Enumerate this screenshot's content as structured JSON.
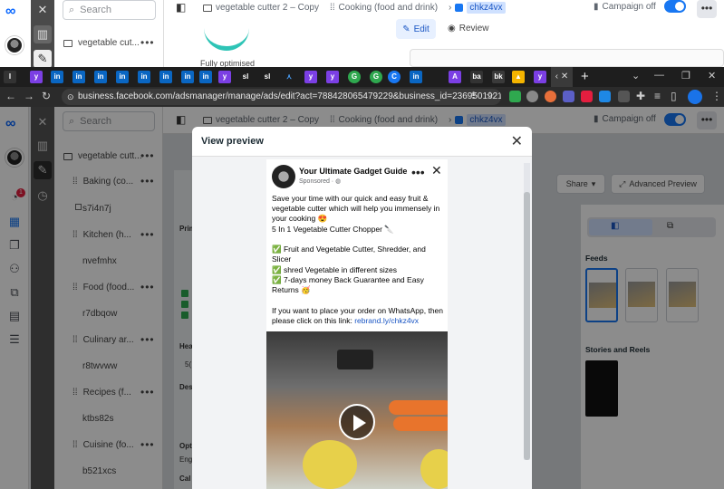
{
  "background_window": {
    "search_placeholder": "Search",
    "tree_item": "vegetable cut...",
    "tree_item2": "Baking (co...",
    "breadcrumb": {
      "campaign": "vegetable cutter 2 – Copy",
      "adset": "Cooking (food and drink)",
      "ad": "chkz4vx"
    },
    "campaign_status": "Campaign off",
    "edit_label": "Edit",
    "review_label": "Review",
    "fully_optimised": "Fully optimised"
  },
  "browser": {
    "url": "business.facebook.com/adsmanager/manage/ads/edit?act=788428065479229&business_id=23695019217...",
    "tab_icons": [
      "li",
      "li",
      "li",
      "li",
      "li",
      "li",
      "li",
      "li",
      "li",
      "y",
      "sl",
      "sl",
      "up",
      "y",
      "y",
      "g",
      "g",
      "c",
      "li",
      "a",
      "ba",
      "g",
      "y"
    ],
    "active_tab_label": "‹"
  },
  "sidebar": {
    "notification_count": "1"
  },
  "tree": {
    "items": [
      {
        "label": "vegetable cutt...",
        "kind": "campaign"
      },
      {
        "label": "Baking (co...",
        "kind": "adset"
      },
      {
        "label": "s7i4n7j",
        "kind": "ad"
      },
      {
        "label": "Kitchen (h...",
        "kind": "adset"
      },
      {
        "label": "nvefmhx",
        "kind": "ad"
      },
      {
        "label": "Food (food...",
        "kind": "adset"
      },
      {
        "label": "r7dbqow",
        "kind": "ad"
      },
      {
        "label": "Culinary ar...",
        "kind": "adset"
      },
      {
        "label": "r8twvww",
        "kind": "ad"
      },
      {
        "label": "Recipes (f...",
        "kind": "adset"
      },
      {
        "label": "ktbs82s",
        "kind": "ad"
      },
      {
        "label": "Cuisine (fo...",
        "kind": "adset"
      },
      {
        "label": "b521xcs",
        "kind": "ad"
      }
    ]
  },
  "topbar": {
    "breadcrumb": {
      "campaign": "vegetable cutter 2 – Copy",
      "adset": "Cooking (food and drink)",
      "ad": "chkz4vx"
    },
    "campaign_status": "Campaign off"
  },
  "right_panel": {
    "share_label": "Share",
    "advanced_preview_label": "Advanced Preview",
    "feeds_label": "Feeds",
    "stories_label": "Stories and Reels"
  },
  "left_content_ghosts": {
    "prim": "Prim",
    "head": "Hea",
    "desc": "Des",
    "opt": "Opt",
    "enga": "Enga",
    "cal": "Cal",
    "s5": "5("
  },
  "modal": {
    "title": "View preview",
    "ad": {
      "page_name": "Your Ultimate Gadget Guide",
      "sponsored": "Sponsored · ",
      "line1": "Save your time with our quick and easy fruit & vegetable cutter which will help you immensely in your cooking 😍",
      "line2": "5 In 1 Vegetable Cutter Chopper 🔪",
      "bullet1": "✅ Fruit and Vegetable Cutter, Shredder, and Slicer",
      "bullet2": "✅ shred Vegetable in different sizes",
      "bullet3": "✅ 7-days money Back Guarantee and Easy Returns 🥳",
      "cta_text": "If you want to place your order on WhatsApp, then please click on this link: ",
      "cta_link": "rebrand.ly/chkz4vx"
    }
  },
  "colors": {
    "accent": "#1877f2",
    "meta_blue": "#0866ff",
    "link": "#1a56c4",
    "badge": "#e41e3f"
  }
}
